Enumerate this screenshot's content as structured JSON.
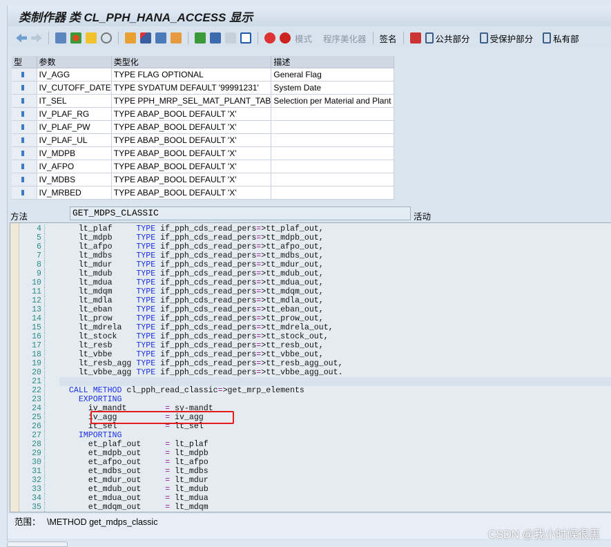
{
  "window": {
    "title": "类制作器 类 CL_PPH_HANA_ACCESS 显示"
  },
  "toolbar": {
    "mode": "模式",
    "pretty_printer": "程序美化器",
    "signature": "签名",
    "public": "公共部分",
    "protected": "受保护部分",
    "private": "私有部"
  },
  "params": {
    "headers": [
      "型",
      "参数",
      "类型化",
      "描述"
    ],
    "rows": [
      [
        "IV_AGG",
        "TYPE FLAG OPTIONAL",
        "General Flag"
      ],
      [
        "IV_CUTOFF_DATE",
        "TYPE SYDATUM  DEFAULT '99991231'",
        "System Date"
      ],
      [
        "IT_SEL",
        "TYPE PPH_MRP_SEL_MAT_PLANT_TAB",
        "Selection per Material and Plant"
      ],
      [
        "IV_PLAF_RG",
        "TYPE ABAP_BOOL  DEFAULT 'X'",
        ""
      ],
      [
        "IV_PLAF_PW",
        "TYPE ABAP_BOOL  DEFAULT 'X'",
        ""
      ],
      [
        "IV_PLAF_UL",
        "TYPE ABAP_BOOL  DEFAULT 'X'",
        ""
      ],
      [
        "IV_MDPB",
        "TYPE ABAP_BOOL  DEFAULT 'X'",
        ""
      ],
      [
        "IV_AFPO",
        "TYPE ABAP_BOOL  DEFAULT 'X'",
        ""
      ],
      [
        "IV_MDBS",
        "TYPE ABAP_BOOL  DEFAULT 'X'",
        ""
      ],
      [
        "IV_MRBED",
        "TYPE ABAP_BOOL  DEFAULT 'X'",
        ""
      ]
    ]
  },
  "method": {
    "label": "方法",
    "name": "GET_MDPS_CLASSIC",
    "status": "活动"
  },
  "code": [
    {
      "n": "4",
      "t": "    lt_plaf     |TYPE| if_pph_cds_read_pers=>tt_plaf_out,"
    },
    {
      "n": "5",
      "t": "    lt_mdpb     |TYPE| if_pph_cds_read_pers=>tt_mdpb_out,"
    },
    {
      "n": "6",
      "t": "    lt_afpo     |TYPE| if_pph_cds_read_pers=>tt_afpo_out,"
    },
    {
      "n": "7",
      "t": "    lt_mdbs     |TYPE| if_pph_cds_read_pers=>tt_mdbs_out,"
    },
    {
      "n": "8",
      "t": "    lt_mdur     |TYPE| if_pph_cds_read_pers=>tt_mdur_out,"
    },
    {
      "n": "9",
      "t": "    lt_mdub     |TYPE| if_pph_cds_read_pers=>tt_mdub_out,"
    },
    {
      "n": "10",
      "t": "    lt_mdua     |TYPE| if_pph_cds_read_pers=>tt_mdua_out,"
    },
    {
      "n": "11",
      "t": "    lt_mdqm     |TYPE| if_pph_cds_read_pers=>tt_mdqm_out,"
    },
    {
      "n": "12",
      "t": "    lt_mdla     |TYPE| if_pph_cds_read_pers=>tt_mdla_out,"
    },
    {
      "n": "13",
      "t": "    lt_eban     |TYPE| if_pph_cds_read_pers=>tt_eban_out,"
    },
    {
      "n": "14",
      "t": "    lt_prow     |TYPE| if_pph_cds_read_pers=>tt_prow_out,"
    },
    {
      "n": "15",
      "t": "    lt_mdrela   |TYPE| if_pph_cds_read_pers=>tt_mdrela_out,"
    },
    {
      "n": "16",
      "t": "    lt_stock    |TYPE| if_pph_cds_read_pers=>tt_stock_out,"
    },
    {
      "n": "17",
      "t": "    lt_resb     |TYPE| if_pph_cds_read_pers=>tt_resb_out,"
    },
    {
      "n": "18",
      "t": "    lt_vbbe     |TYPE| if_pph_cds_read_pers=>tt_vbbe_out,"
    },
    {
      "n": "19",
      "t": "    lt_resb_agg |TYPE| if_pph_cds_read_pers=>tt_resb_agg_out,"
    },
    {
      "n": "20",
      "t": "    lt_vbbe_agg |TYPE| if_pph_cds_read_pers=>tt_vbbe_agg_out."
    },
    {
      "n": "21",
      "t": "",
      "hl": true
    },
    {
      "n": "22",
      "t": "  |CALL METHOD| cl_pph_read_classic=>get_mrp_elements"
    },
    {
      "n": "23",
      "t": "    |EXPORTING|"
    },
    {
      "n": "24",
      "t": "      iv_mandt        ~=~ sy-mandt"
    },
    {
      "n": "25",
      "t": "      iv_agg          ~=~ iv_agg"
    },
    {
      "n": "26",
      "t": "      it_sel          ~=~ lt_sel"
    },
    {
      "n": "27",
      "t": "    |IMPORTING|"
    },
    {
      "n": "28",
      "t": "      et_plaf_out     ~=~ lt_plaf"
    },
    {
      "n": "29",
      "t": "      et_mdpb_out     ~=~ lt_mdpb"
    },
    {
      "n": "30",
      "t": "      et_afpo_out     ~=~ lt_afpo"
    },
    {
      "n": "31",
      "t": "      et_mdbs_out     ~=~ lt_mdbs"
    },
    {
      "n": "32",
      "t": "      et_mdur_out     ~=~ lt_mdur"
    },
    {
      "n": "33",
      "t": "      et_mdub_out     ~=~ lt_mdub"
    },
    {
      "n": "34",
      "t": "      et_mdua_out     ~=~ lt_mdua"
    },
    {
      "n": "35",
      "t": "      et_mdqm_out     ~=~ lt_mdqm"
    }
  ],
  "status": {
    "label": "范围：",
    "value": "\\METHOD get_mdps_classic"
  },
  "watermark": "CSDN @我小时候很黑",
  "colors": {
    "keyword": "#1a2ee6",
    "operator": "#9a1a9a",
    "highlight_box": "#e21a1a"
  }
}
